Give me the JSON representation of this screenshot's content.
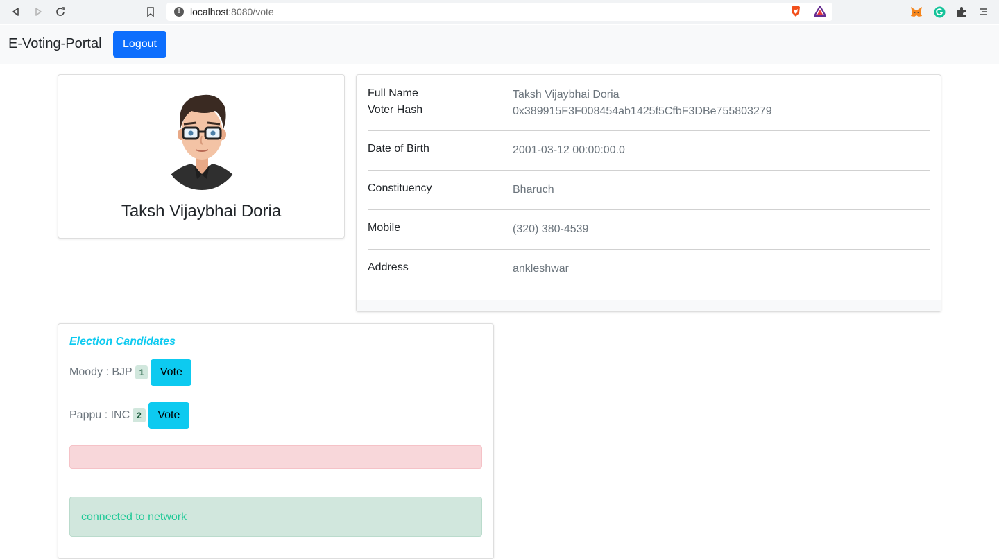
{
  "browser": {
    "url_host": "localhost",
    "url_path": ":8080/vote"
  },
  "navbar": {
    "brand": "E-Voting-Portal",
    "logout_label": "Logout"
  },
  "profile": {
    "name": "Taksh Vijaybhai Doria"
  },
  "details": [
    {
      "label": "Full Name",
      "value": "Taksh Vijaybhai Doria"
    },
    {
      "label": "Voter Hash",
      "value": "0x389915F3F008454ab1425f5CfbF3DBe755803279"
    },
    {
      "label": "Date of Birth",
      "value": "2001-03-12 00:00:00.0"
    },
    {
      "label": "Constituency",
      "value": "Bharuch"
    },
    {
      "label": "Mobile",
      "value": "(320) 380-4539"
    },
    {
      "label": "Address",
      "value": "ankleshwar"
    }
  ],
  "candidates": {
    "title": "Election Candidates",
    "items": [
      {
        "text": "Moody : BJP",
        "badge": "1",
        "vote_label": "Vote"
      },
      {
        "text": "Pappu : INC",
        "badge": "2",
        "vote_label": "Vote"
      }
    ],
    "error_message": "",
    "status_message": "connected to network"
  },
  "colors": {
    "primary": "#0d6efd",
    "info": "#0dcaf0",
    "danger_bg": "#f8d7da",
    "success_bg": "#d1e7dd",
    "success_text": "#20c997"
  }
}
